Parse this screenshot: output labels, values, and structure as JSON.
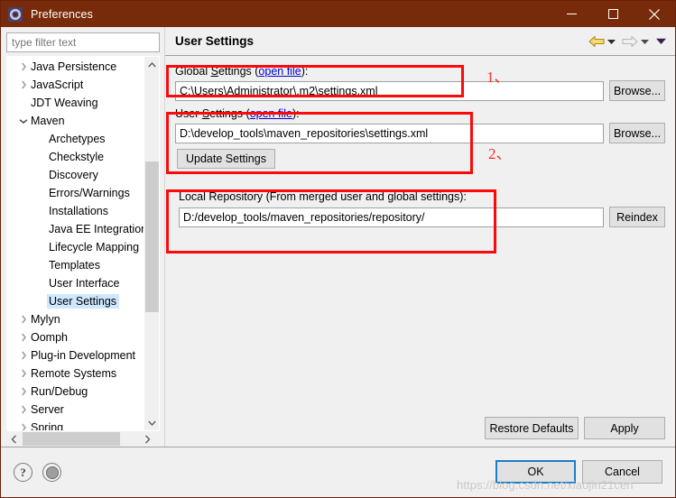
{
  "window": {
    "title": "Preferences",
    "icon": "gear-icon",
    "titlebar_color": "#782b0a",
    "controls": {
      "minimize": "minimize-icon",
      "maximize": "maximize-icon",
      "close": "close-icon"
    }
  },
  "sidebar": {
    "filter": {
      "placeholder": "type filter text",
      "value": ""
    },
    "items": [
      {
        "label": "Java Persistence",
        "level": 0,
        "expandable": true,
        "expanded": false,
        "selected": false
      },
      {
        "label": "JavaScript",
        "level": 0,
        "expandable": true,
        "expanded": false,
        "selected": false
      },
      {
        "label": "JDT Weaving",
        "level": 0,
        "expandable": false,
        "expanded": false,
        "selected": false
      },
      {
        "label": "Maven",
        "level": 0,
        "expandable": true,
        "expanded": true,
        "selected": false
      },
      {
        "label": "Archetypes",
        "level": 1,
        "expandable": false,
        "expanded": false,
        "selected": false
      },
      {
        "label": "Checkstyle",
        "level": 1,
        "expandable": false,
        "expanded": false,
        "selected": false
      },
      {
        "label": "Discovery",
        "level": 1,
        "expandable": false,
        "expanded": false,
        "selected": false
      },
      {
        "label": "Errors/Warnings",
        "level": 1,
        "expandable": false,
        "expanded": false,
        "selected": false
      },
      {
        "label": "Installations",
        "level": 1,
        "expandable": false,
        "expanded": false,
        "selected": false
      },
      {
        "label": "Java EE Integration",
        "level": 1,
        "expandable": false,
        "expanded": false,
        "selected": false
      },
      {
        "label": "Lifecycle Mapping",
        "level": 1,
        "expandable": false,
        "expanded": false,
        "selected": false
      },
      {
        "label": "Templates",
        "level": 1,
        "expandable": false,
        "expanded": false,
        "selected": false
      },
      {
        "label": "User Interface",
        "level": 1,
        "expandable": false,
        "expanded": false,
        "selected": false
      },
      {
        "label": "User Settings",
        "level": 1,
        "expandable": false,
        "expanded": false,
        "selected": true
      },
      {
        "label": "Mylyn",
        "level": 0,
        "expandable": true,
        "expanded": false,
        "selected": false
      },
      {
        "label": "Oomph",
        "level": 0,
        "expandable": true,
        "expanded": false,
        "selected": false
      },
      {
        "label": "Plug-in Development",
        "level": 0,
        "expandable": true,
        "expanded": false,
        "selected": false
      },
      {
        "label": "Remote Systems",
        "level": 0,
        "expandable": true,
        "expanded": false,
        "selected": false
      },
      {
        "label": "Run/Debug",
        "level": 0,
        "expandable": true,
        "expanded": false,
        "selected": false
      },
      {
        "label": "Server",
        "level": 0,
        "expandable": true,
        "expanded": false,
        "selected": false
      },
      {
        "label": "Spring",
        "level": 0,
        "expandable": true,
        "expanded": false,
        "selected": false
      }
    ],
    "scrollbars": {
      "vertical": "tree-vertical-scrollbar",
      "horizontal": "tree-horizontal-scrollbar"
    }
  },
  "page": {
    "title": "User Settings",
    "nav": {
      "back": "back-arrow-icon",
      "back_menu": "chevron-down-icon",
      "forward": "forward-arrow-icon",
      "forward_menu": "chevron-down-icon",
      "view_menu": "chevron-down-icon"
    },
    "global_settings": {
      "label_prefix": "Global ",
      "label_underlined": "S",
      "label_suffix": "ettings (",
      "link": "open file",
      "label_end": "):",
      "value": "C:\\Users\\Administrator\\.m2\\settings.xml",
      "browse_label": "Browse..."
    },
    "user_settings": {
      "label_prefix": "User ",
      "label_underlined": "S",
      "label_suffix": "ettings (",
      "link": "open file",
      "label_end": "):",
      "value": "D:\\develop_tools\\maven_repositories\\settings.xml",
      "browse_label": "Browse...",
      "update_label": "Update Settings"
    },
    "local_repository": {
      "label": "Local Repository (From merged user and global settings):",
      "value": "D:/develop_tools/maven_repositories/repository/",
      "reindex_label": "Reindex"
    },
    "annotations": [
      {
        "text": "1、",
        "color": "#ff2d2d"
      },
      {
        "text": "2、",
        "color": "#ff2d2d"
      }
    ],
    "highlight_color": "#fa0a0a",
    "restore_defaults_label": "Restore Defaults",
    "apply_label": "Apply"
  },
  "footer": {
    "help_icon": "?",
    "shell_icon": "shell-status-icon",
    "ok_label": "OK",
    "cancel_label": "Cancel"
  },
  "watermark": "https://blog.csdn.net/xiaojin21cen"
}
